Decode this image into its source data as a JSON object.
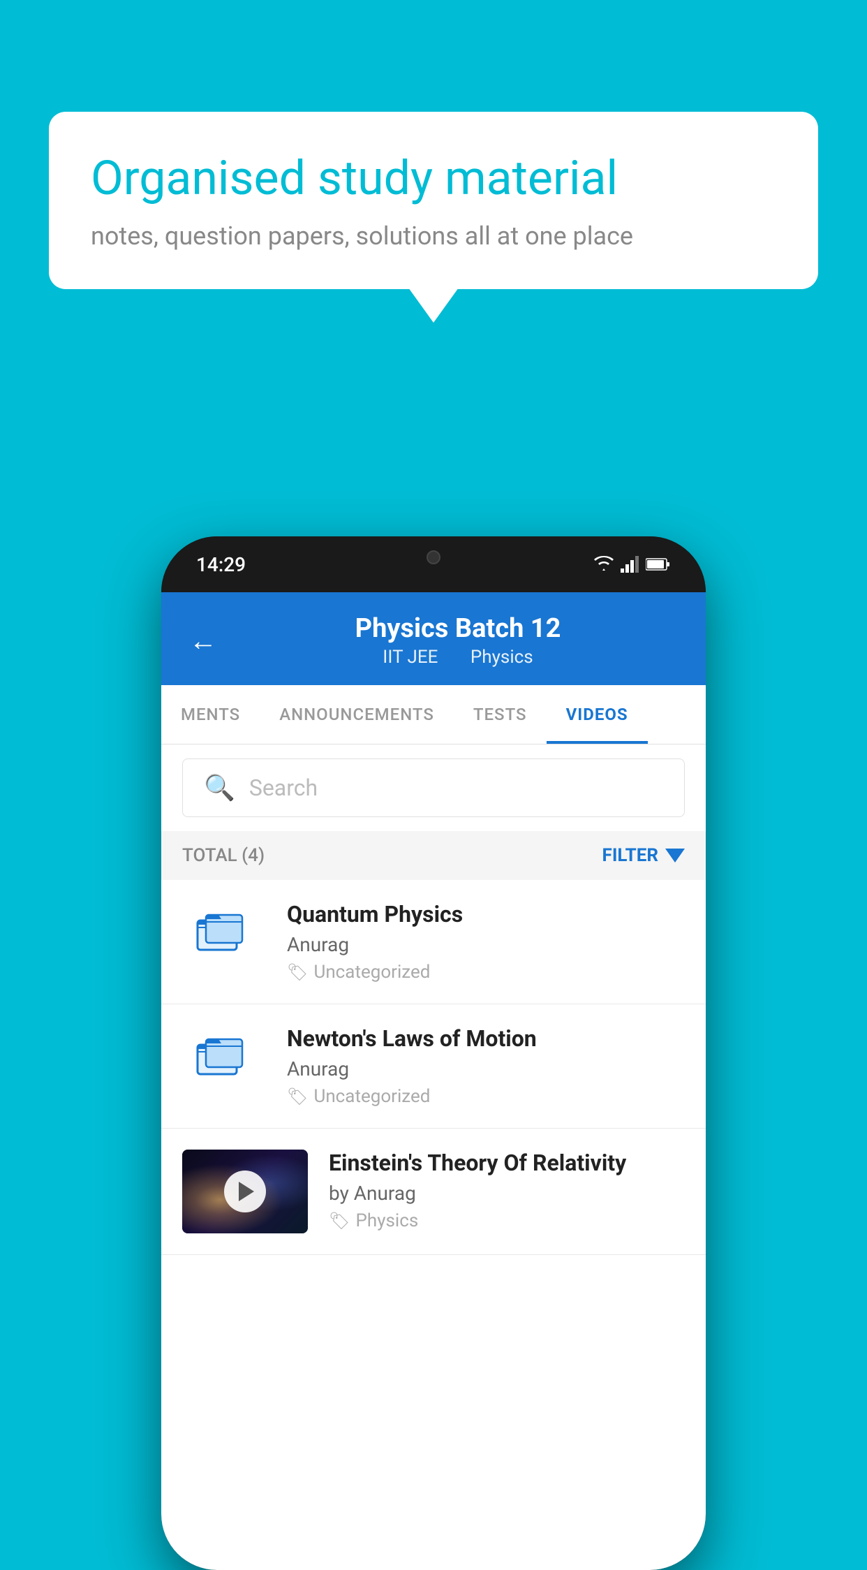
{
  "background_color": "#00bcd4",
  "speech_bubble": {
    "title": "Organised study material",
    "subtitle": "notes, question papers, solutions all at one place"
  },
  "phone": {
    "status_bar": {
      "time": "14:29"
    },
    "header": {
      "title": "Physics Batch 12",
      "subtitle_part1": "IIT JEE",
      "subtitle_part2": "Physics",
      "back_label": "←"
    },
    "tabs": [
      {
        "label": "MENTS",
        "active": false
      },
      {
        "label": "ANNOUNCEMENTS",
        "active": false
      },
      {
        "label": "TESTS",
        "active": false
      },
      {
        "label": "VIDEOS",
        "active": true
      }
    ],
    "search": {
      "placeholder": "Search"
    },
    "filter_bar": {
      "total_label": "TOTAL (4)",
      "filter_label": "FILTER"
    },
    "videos": [
      {
        "id": "quantum-physics",
        "title": "Quantum Physics",
        "author": "Anurag",
        "tag": "Uncategorized",
        "type": "folder",
        "has_thumbnail": false
      },
      {
        "id": "newtons-laws",
        "title": "Newton's Laws of Motion",
        "author": "Anurag",
        "tag": "Uncategorized",
        "type": "folder",
        "has_thumbnail": false
      },
      {
        "id": "einstein-relativity",
        "title": "Einstein's Theory Of Relativity",
        "author": "by Anurag",
        "tag": "Physics",
        "type": "video",
        "has_thumbnail": true
      }
    ]
  }
}
